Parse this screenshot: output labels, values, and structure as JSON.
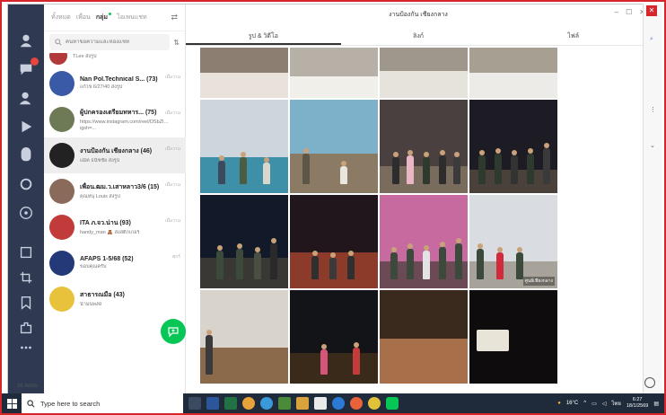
{
  "colors": {
    "frame": "#d7262b",
    "rail": "#2f3a52",
    "accent": "#06c755",
    "taskbar": "#1f2b3b"
  },
  "rail_icons": [
    "person-icon",
    "chat-icon",
    "add-person-icon",
    "play-icon",
    "sticker-icon",
    "call-icon",
    "open-chat-icon",
    "keep-icon",
    "crop-icon",
    "bookmark-icon",
    "puzzle-icon",
    "more-icon"
  ],
  "chat_list": {
    "tabs": [
      "ทั้งหมด",
      "เพื่อน",
      "กลุ่ม",
      "โอเพนแชท"
    ],
    "active_tab": "กลุ่ม",
    "search_placeholder": "ค้นหาข้อความและห้องแชท",
    "items": [
      {
        "name": "",
        "preview": "TLee ส่งรูป",
        "time": "",
        "avatar": "#b23a3a"
      },
      {
        "name": "Nan Pol.Technical S... (73)",
        "preview": "แก้ไข 6/27/40 ส่งรูป",
        "time": "เมื่อวาน",
        "avatar": "#3a5aa8"
      },
      {
        "name": "ผู้ปกครองเตรียมทหาร... (75)",
        "preview": "https://www.instagram.com/reel/DSbZlonDOWO/?igsh=...",
        "time": "เมื่อวาน",
        "avatar": "#6d7a55"
      },
      {
        "name": "งานป้องกัน เชียงกลาง (46)",
        "preview": "แม็ค ธนัชชัย ส่งรูป",
        "time": "เมื่อวาน",
        "avatar": "#222222"
      },
      {
        "name": "เพื่อน.ฒม.ว.เสาหลาว3/6 (15)",
        "preview": "คุณหนุ Louis ส่งรูป",
        "time": "เมื่อวาน",
        "avatar": "#8a6a5a"
      },
      {
        "name": "ITA ภ.จว.น่าน (93)",
        "preview": "handy_man 🧸 ส่งสติกเกอร์",
        "time": "เมื่อวาน",
        "avatar": "#c23b3b"
      },
      {
        "name": "AFAPS 1-5/68 (52)",
        "preview": "ขอบคุณครับ",
        "time": "ศุกร์",
        "avatar": "#243a78"
      },
      {
        "name": "สาธารณมือ (43)",
        "preview": "น้ำมนพงษ์",
        "time": "",
        "avatar": "#e8c23a"
      }
    ],
    "items_count": "36 items"
  },
  "album": {
    "title": "งานป้องกัน เชียงกลาง",
    "tabs": [
      "รูป & วิดีโอ",
      "ลิงก์",
      "ไฟล์"
    ],
    "active_tab": "รูป & วิดีโอ",
    "photo_caption": "ศูนย์เชียงกลาง"
  },
  "taskbar": {
    "search_placeholder": "Type here to search",
    "weather": "16°C",
    "language": "ไทย",
    "time": "6:27",
    "date": "18/1/2569"
  }
}
